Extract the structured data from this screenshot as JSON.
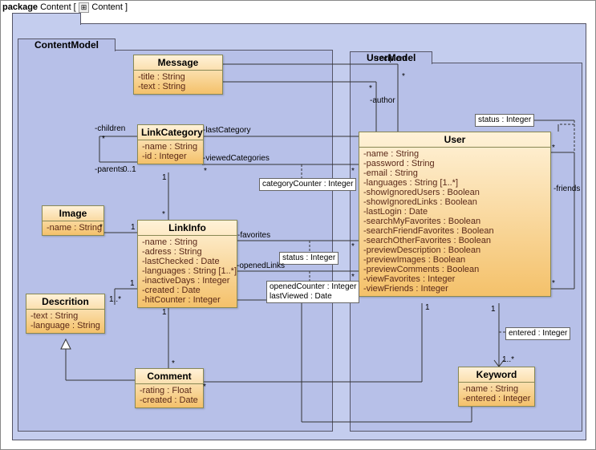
{
  "packageHeader": {
    "label": "package",
    "name": "Content",
    "crumb": "Content"
  },
  "packages": {
    "contentModel": {
      "title": "ContentModel"
    },
    "userModel": {
      "title": "UserModel"
    }
  },
  "classes": {
    "message": {
      "name": "Message",
      "attrs": [
        "-title : String",
        "-text : String"
      ]
    },
    "linkCategory": {
      "name": "LinkCategory",
      "attrs": [
        "-name : String",
        "-id : Integer"
      ]
    },
    "image": {
      "name": "Image",
      "attrs": [
        "-name : String"
      ]
    },
    "linkInfo": {
      "name": "LinkInfo",
      "attrs": [
        "-name : String",
        "-adress : String",
        "-lastChecked : Date",
        "-languages : String [1..*]",
        "-inactiveDays : Integer",
        "-created : Date",
        "-hitCounter : Integer"
      ]
    },
    "description": {
      "name": "Descrition",
      "attrs": [
        "-text : String",
        "-language : String"
      ]
    },
    "comment": {
      "name": "Comment",
      "attrs": [
        "-rating : Float",
        "-created : Date"
      ]
    },
    "user": {
      "name": "User",
      "attrs": [
        "-name : String",
        "-password : String",
        "-email : String",
        "-languages : String [1..*]",
        "-showIgnoredUsers : Boolean",
        "-showIgnoredLinks : Boolean",
        "-lastLogin : Date",
        "-searchMyFavorites : Boolean",
        "-searchFriendFavorites : Boolean",
        "-searchOtherFavorites : Boolean",
        "-previewDescription : Boolean",
        "-previewImages : Boolean",
        "-previewComments : Boolean",
        "-viewFavorites : Integer",
        "-viewFriends : Integer"
      ]
    },
    "keyword": {
      "name": "Keyword",
      "attrs": [
        "-name : String",
        "-entered : Integer"
      ]
    }
  },
  "assocNotes": {
    "categoryCounter": "categoryCounter : Integer",
    "statusUser": "status : Integer",
    "statusFav": "status : Integer",
    "openedLinks": "openedCounter : Integer\nlastViewed : Date",
    "enteredKw": "entered : Integer"
  },
  "labels": {
    "recipient": "-recipient",
    "author": "-author",
    "children": "-children",
    "parents": "-parents",
    "lastCategory": "-lastCategory",
    "viewedCategories": "-viewedCategories",
    "favorites": "-favorites",
    "openedLinks": "-openedLinks",
    "friends": "-friends",
    "m_star": "*",
    "m_0_1": "0..1",
    "m_1": "1",
    "m_1p": "1..*",
    "m_1_star": "1..*"
  },
  "chart_data": {
    "type": "table",
    "description": "UML class diagram, package Content containing two sub-packages ContentModel and UserModel",
    "classes": [
      {
        "name": "Message",
        "package": "ContentModel",
        "attributes": [
          "title:String",
          "text:String"
        ]
      },
      {
        "name": "LinkCategory",
        "package": "ContentModel",
        "attributes": [
          "name:String",
          "id:Integer"
        ]
      },
      {
        "name": "Image",
        "package": "ContentModel",
        "attributes": [
          "name:String"
        ]
      },
      {
        "name": "LinkInfo",
        "package": "ContentModel",
        "attributes": [
          "name:String",
          "adress:String",
          "lastChecked:Date",
          "languages:String[1..*]",
          "inactiveDays:Integer",
          "created:Date",
          "hitCounter:Integer"
        ]
      },
      {
        "name": "Descrition",
        "package": "ContentModel",
        "attributes": [
          "text:String",
          "language:String"
        ]
      },
      {
        "name": "Comment",
        "package": "ContentModel",
        "attributes": [
          "rating:Float",
          "created:Date"
        ]
      },
      {
        "name": "User",
        "package": "UserModel",
        "attributes": [
          "name:String",
          "password:String",
          "email:String",
          "languages:String[1..*]",
          "showIgnoredUsers:Boolean",
          "showIgnoredLinks:Boolean",
          "lastLogin:Date",
          "searchMyFavorites:Boolean",
          "searchFriendFavorites:Boolean",
          "searchOtherFavorites:Boolean",
          "previewDescription:Boolean",
          "previewImages:Boolean",
          "previewComments:Boolean",
          "viewFavorites:Integer",
          "viewFriends:Integer"
        ]
      },
      {
        "name": "Keyword",
        "package": "UserModel",
        "attributes": [
          "name:String",
          "entered:Integer"
        ]
      }
    ],
    "associations": [
      {
        "from": "Message",
        "to": "User",
        "role": "recipient",
        "mult": "*"
      },
      {
        "from": "Message",
        "to": "User",
        "role": "author",
        "mult": "*"
      },
      {
        "from": "LinkCategory",
        "to": "LinkCategory",
        "role": "children/parents",
        "mult": "* / 0..1"
      },
      {
        "from": "LinkCategory",
        "to": "User",
        "role": "lastCategory"
      },
      {
        "from": "LinkCategory",
        "to": "User",
        "role": "viewedCategories",
        "mult": "*",
        "assocClassAttr": "categoryCounter:Integer"
      },
      {
        "from": "LinkCategory",
        "to": "LinkInfo",
        "mult": "1 - *"
      },
      {
        "from": "LinkInfo",
        "to": "User",
        "role": "favorites",
        "mult": "*",
        "assocClassAttr": "status:Integer"
      },
      {
        "from": "LinkInfo",
        "to": "User",
        "role": "openedLinks",
        "mult": "*",
        "assocClassAttr": "openedCounter:Integer, lastViewed:Date"
      },
      {
        "from": "LinkInfo",
        "to": "Image",
        "mult": "1 - *"
      },
      {
        "from": "LinkInfo",
        "to": "Descrition",
        "mult": "1 - 1..*"
      },
      {
        "from": "LinkInfo",
        "to": "Comment",
        "mult": "1 - *"
      },
      {
        "from": "Comment",
        "to": "Descrition",
        "generalization": true
      },
      {
        "from": "Comment",
        "to": "User",
        "mult": "* - 1"
      },
      {
        "from": "User",
        "to": "User",
        "role": "friends",
        "mult": "* - *",
        "assocClassAttr": "status:Integer"
      },
      {
        "from": "User",
        "to": "Keyword",
        "mult": "1 - 1..*",
        "assocClassAttr": "entered:Integer"
      }
    ]
  }
}
